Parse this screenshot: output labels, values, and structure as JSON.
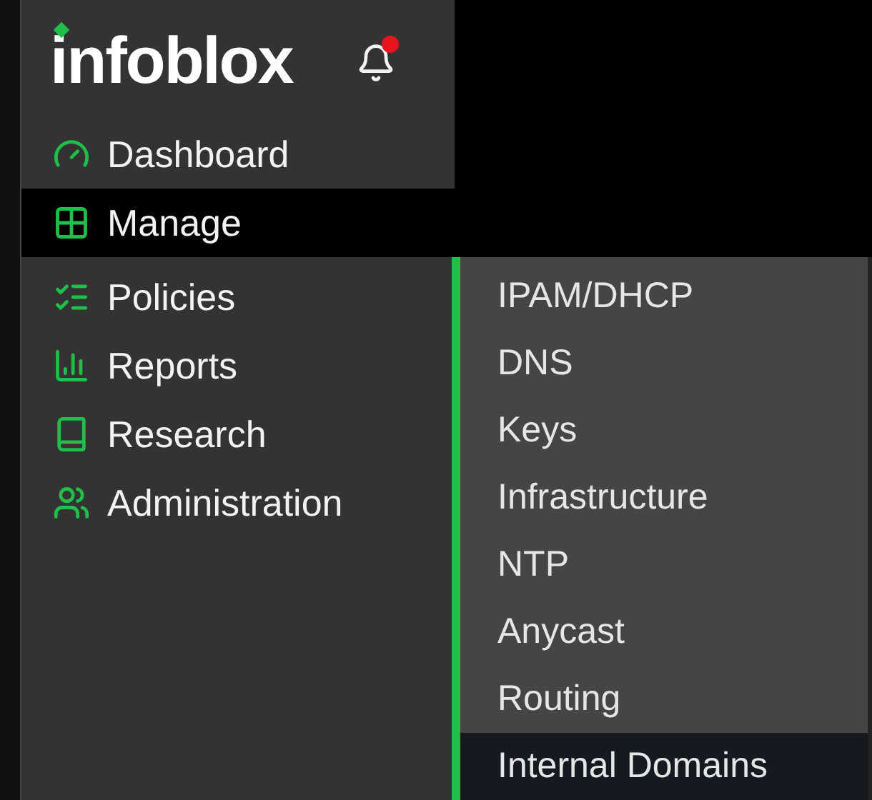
{
  "header": {
    "logo": "infoblox",
    "notifications": {
      "unread": true
    }
  },
  "nav": [
    {
      "label": "Dashboard",
      "selected": false
    },
    {
      "label": "Manage",
      "selected": true
    },
    {
      "label": "Policies",
      "selected": false
    },
    {
      "label": "Reports",
      "selected": false
    },
    {
      "label": "Research",
      "selected": false
    },
    {
      "label": "Administration",
      "selected": false
    }
  ],
  "submenu": [
    {
      "label": "IPAM/DHCP",
      "selected": false
    },
    {
      "label": "DNS",
      "selected": false
    },
    {
      "label": "Keys",
      "selected": false
    },
    {
      "label": "Infrastructure",
      "selected": false
    },
    {
      "label": "NTP",
      "selected": false
    },
    {
      "label": "Anycast",
      "selected": false
    },
    {
      "label": "Routing",
      "selected": false
    },
    {
      "label": "Internal Domains",
      "selected": true
    }
  ]
}
